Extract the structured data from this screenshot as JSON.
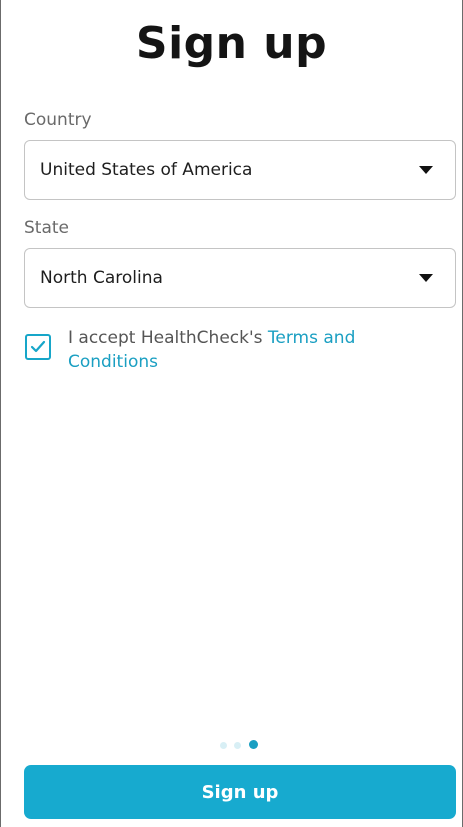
{
  "page": {
    "title": "Sign up"
  },
  "form": {
    "country": {
      "label": "Country",
      "value": "United States of America"
    },
    "state": {
      "label": "State",
      "value": "North Carolina"
    },
    "terms": {
      "checked": true,
      "prefix": "I accept HealthCheck's ",
      "link": "Terms and Conditions"
    }
  },
  "pagination": {
    "total": 3,
    "active_index": 2
  },
  "actions": {
    "submit_label": "Sign up"
  },
  "colors": {
    "accent": "#17aacf",
    "link": "#1a9fc2"
  },
  "icons": {
    "dropdown": "caret-down-icon",
    "checkbox": "check-icon"
  }
}
